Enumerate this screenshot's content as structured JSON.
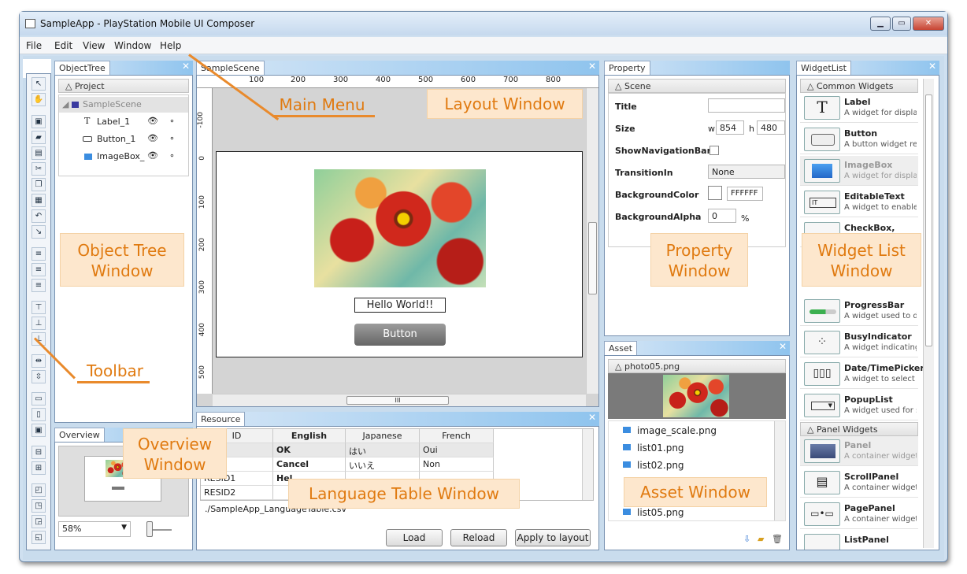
{
  "window": {
    "title": "SampleApp - PlayStation Mobile UI Composer"
  },
  "menu": [
    "File",
    "Edit",
    "View",
    "Window",
    "Help"
  ],
  "object_tree": {
    "tab": "ObjectTree",
    "section": "Project",
    "items": [
      {
        "label": "SampleScene"
      },
      {
        "label": "Label_1"
      },
      {
        "label": "Button_1"
      },
      {
        "label": "ImageBox_"
      }
    ]
  },
  "scene": {
    "tab": "SampleScene",
    "ruler_h": [
      "100",
      "200",
      "300",
      "400",
      "500",
      "600",
      "700",
      "800"
    ],
    "ruler_v": [
      "-100",
      "0",
      "100",
      "200",
      "300",
      "400",
      "500"
    ],
    "label_text": "Hello World!!",
    "button_text": "Button",
    "hscroll_mark": "III"
  },
  "overview": {
    "tab": "Overview",
    "zoom": "58%"
  },
  "resource": {
    "tab": "Resource",
    "headers": [
      "ID",
      "English",
      "Japanese",
      "French"
    ],
    "rows": [
      [
        "",
        "OK",
        "はい",
        "Oui"
      ],
      [
        "ncel",
        "Cancel",
        "いいえ",
        "Non"
      ],
      [
        "RESID1",
        "Hel",
        "",
        ""
      ],
      [
        "RESID2",
        "",
        "",
        ""
      ]
    ],
    "file": "./SampleApp_LanguageTable.csv",
    "buttons": {
      "load": "Load",
      "reload": "Reload",
      "apply": "Apply to layout"
    }
  },
  "property": {
    "tab": "Property",
    "section": "Scene",
    "title_label": "Title",
    "title_value": "",
    "size_label": "Size",
    "w_label": "w",
    "w_value": "854",
    "h_label": "h",
    "h_value": "480",
    "shownav_label": "ShowNavigationBar",
    "transition_label": "TransitionIn",
    "transition_value": "None",
    "bgcolor_label": "BackgroundColor",
    "bgcolor_value": "FFFFFF",
    "bgalpha_label": "BackgroundAlpha",
    "bgalpha_value": "0",
    "bgalpha_unit": "%"
  },
  "asset": {
    "tab": "Asset",
    "section": "photo05.png",
    "files": [
      "image_scale.png",
      "list01.png",
      "list02.png",
      "list05.png"
    ]
  },
  "widget_list": {
    "tab": "WidgetList",
    "common_section": "Common Widgets",
    "common": [
      {
        "name": "Label",
        "desc": "A widget for displayin",
        "glyph": "T"
      },
      {
        "name": "Button",
        "desc": "A button widget resp",
        "glyph": ""
      },
      {
        "name": "ImageBox",
        "desc": "A widget for displayi",
        "glyph": ""
      },
      {
        "name": "EditableText",
        "desc": "A widget to enable te",
        "glyph": "IT"
      },
      {
        "name": "CheckBox, RadioB",
        "desc": "",
        "glyph": ""
      },
      {
        "name": "ProgressBar",
        "desc": "A widget used to disp",
        "glyph": ""
      },
      {
        "name": "BusyIndicator",
        "desc": "A widget indicating t",
        "glyph": ""
      },
      {
        "name": "Date/TimePicker",
        "desc": "A widget to select th",
        "glyph": ""
      },
      {
        "name": "PopupList",
        "desc": "A widget used for sel",
        "glyph": ""
      }
    ],
    "panel_section": "Panel Widgets",
    "panels": [
      {
        "name": "Panel",
        "desc": "A container widget w"
      },
      {
        "name": "ScrollPanel",
        "desc": "A container widget w"
      },
      {
        "name": "PagePanel",
        "desc": "A container widget th"
      },
      {
        "name": "ListPanel",
        "desc": ""
      }
    ]
  },
  "callouts": {
    "main_menu": "Main Menu",
    "layout": "Layout Window",
    "object_tree": "Object Tree\nWindow",
    "property": "Property\nWindow",
    "widget": "Widget List\nWindow",
    "toolbar": "Toolbar",
    "overview": "Overview\nWindow",
    "language": "Language Table Window",
    "asset": "Asset Window"
  },
  "colors": {
    "callout_text": "#e07a10",
    "callout_bg": "#fde7cd",
    "accent": "#3a7bd5"
  }
}
